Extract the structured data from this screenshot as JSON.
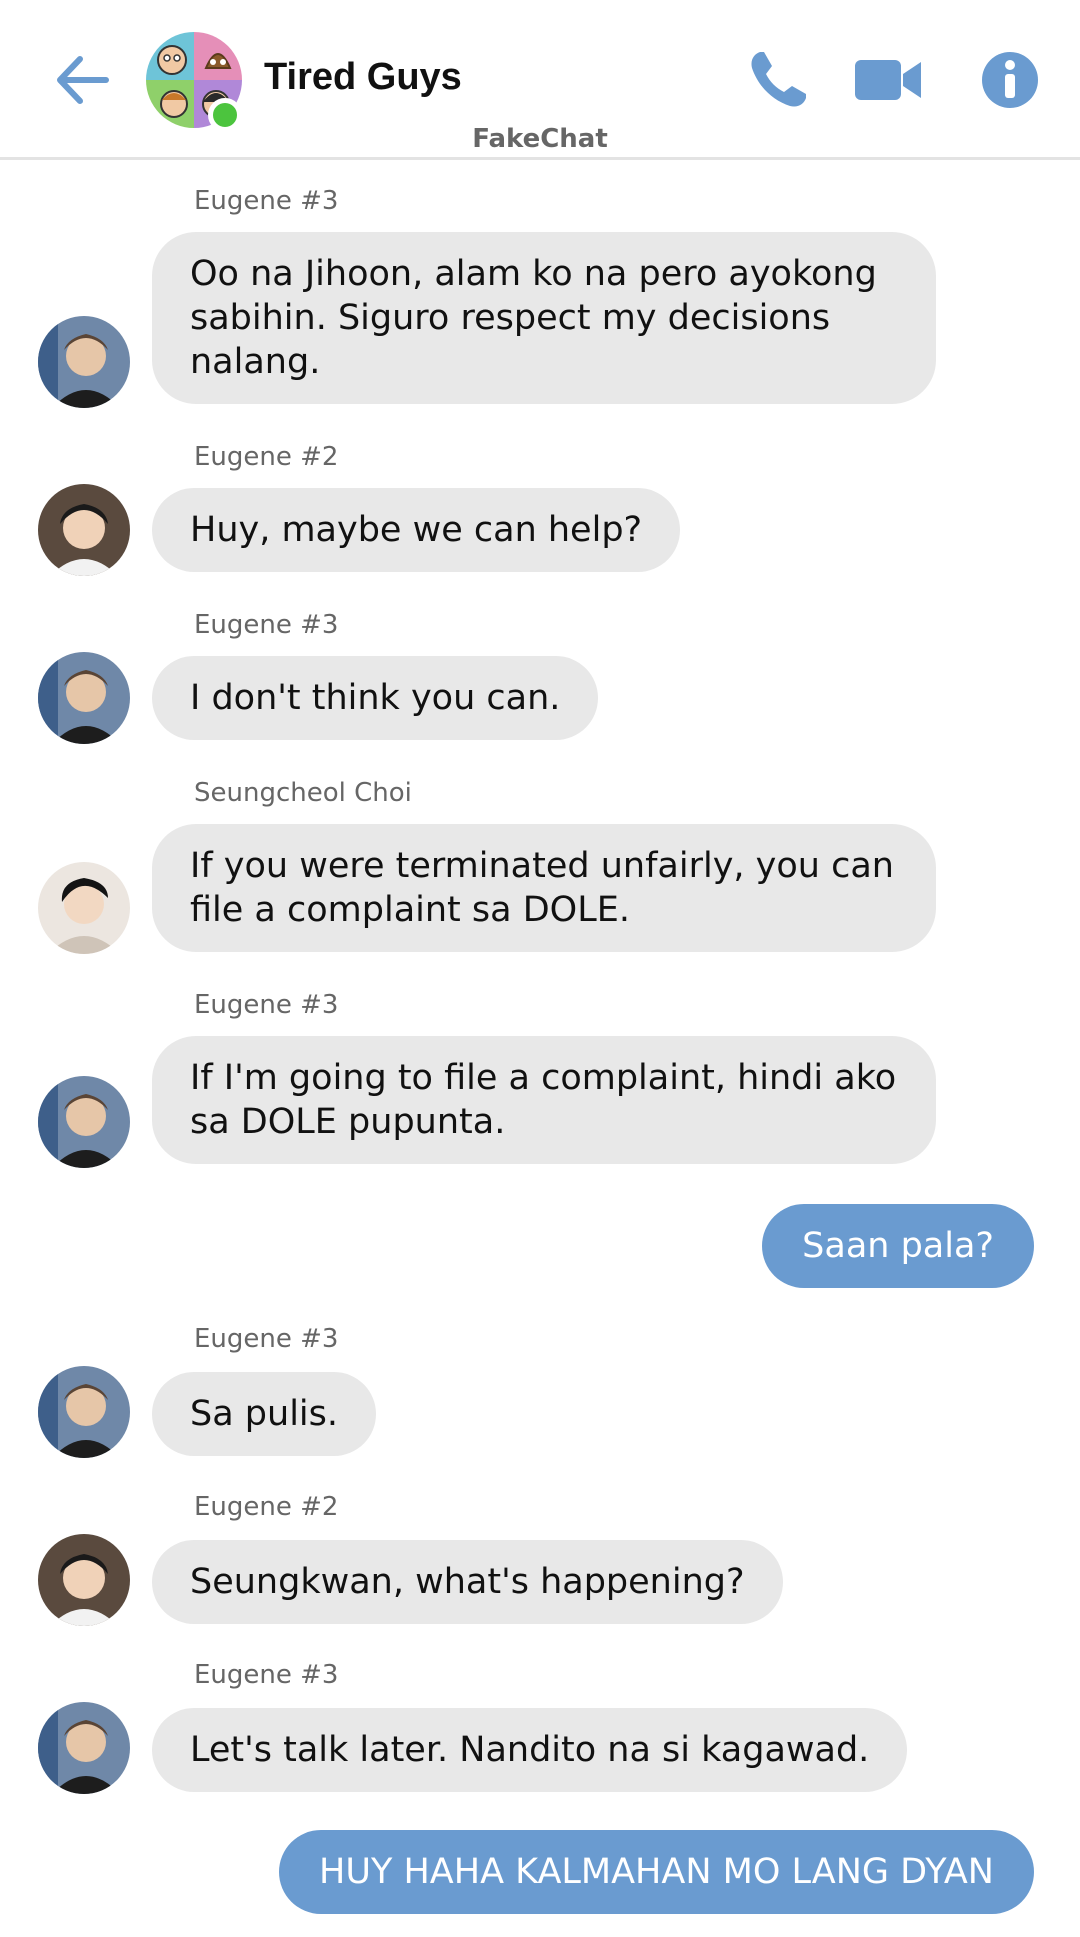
{
  "header": {
    "title": "Tired Guys",
    "icons": [
      "back-arrow-icon",
      "phone-icon",
      "video-camera-icon",
      "info-icon"
    ],
    "accent_color": "#6a9bd0",
    "online_color": "#4cc43e"
  },
  "watermark": "FakeChat",
  "messages": [
    {
      "type": "in",
      "sender": "Eugene #3",
      "text": "Oo na Jihoon, alam ko na pero ayokong sabihin. Siguro respect my decisions nalang."
    },
    {
      "type": "in",
      "sender": "Eugene #2",
      "text": "Huy, maybe we can help?"
    },
    {
      "type": "in",
      "sender": "Eugene #3",
      "text": "I don't think you can."
    },
    {
      "type": "in",
      "sender": "Seungcheol Choi",
      "text": "If you were terminated unfairly, you can file a complaint sa DOLE."
    },
    {
      "type": "in",
      "sender": "Eugene #3",
      "text": "If I'm going to file a complaint, hindi ako sa DOLE pupunta."
    },
    {
      "type": "out",
      "text": "Saan pala?"
    },
    {
      "type": "in",
      "sender": "Eugene #3",
      "text": "Sa pulis."
    },
    {
      "type": "in",
      "sender": "Eugene #2",
      "text": "Seungkwan, what's happening?"
    },
    {
      "type": "in",
      "sender": "Eugene #3",
      "text": "Let's talk later. Nandito na si kagawad."
    },
    {
      "type": "out",
      "text": "HUY HAHA KALMAHAN MO LANG DYAN"
    }
  ]
}
